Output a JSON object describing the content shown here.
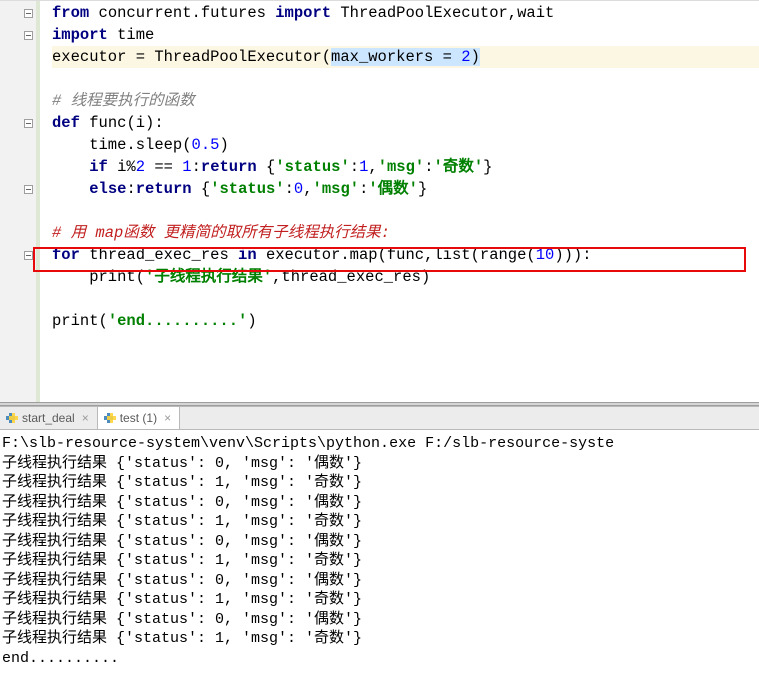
{
  "code": {
    "l1a": "from",
    "l1b": " concurrent.futures ",
    "l1c": "import",
    "l1d": " ThreadPoolExecutor,wait",
    "l2a": "import",
    "l2b": " time",
    "l3a": "executor = ThreadPoolExecutor(",
    "l3b": "max_workers = ",
    "l3c": "2",
    "l3d": ")",
    "l5": "# 线程要执行的函数",
    "l6a": "def ",
    "l6b": "func",
    "l6c": "(i):",
    "l7a": "    time.sleep(",
    "l7b": "0.5",
    "l7c": ")",
    "l8a": "    ",
    "l8b": "if ",
    "l8c": "i%",
    "l8d": "2",
    "l8e": " == ",
    "l8f": "1",
    "l8g": ":",
    "l8h": "return ",
    "l8i": "{",
    "l8j": "'status'",
    "l8k": ":",
    "l8l": "1",
    "l8m": ",",
    "l8n": "'msg'",
    "l8o": ":",
    "l8p": "'奇数'",
    "l8q": "}",
    "l9a": "    ",
    "l9b": "else",
    "l9c": ":",
    "l9d": "return ",
    "l9e": "{",
    "l9f": "'status'",
    "l9g": ":",
    "l9h": "0",
    "l9i": ",",
    "l9j": "'msg'",
    "l9k": ":",
    "l9l": "'偶数'",
    "l9m": "}",
    "l11": "# 用 map函数 更精简的取所有子线程执行结果:",
    "l12a": "for ",
    "l12b": "thread_exec_res ",
    "l12c": "in ",
    "l12d": "executor.map(func,list(range(",
    "l12e": "10",
    "l12f": "))):",
    "l13a": "    print(",
    "l13b": "'子线程执行结果'",
    "l13c": ",thread_exec_res)",
    "l15a": "print(",
    "l15b": "'end..........'",
    "l15c": ")"
  },
  "tabs": {
    "t1": "start_deal",
    "t2": "test (1)"
  },
  "console": {
    "path": "F:\\slb-resource-system\\venv\\Scripts\\python.exe F:/slb-resource-syste",
    "rows": [
      "子线程执行结果 {'status': 0, 'msg': '偶数'}",
      "子线程执行结果 {'status': 1, 'msg': '奇数'}",
      "子线程执行结果 {'status': 0, 'msg': '偶数'}",
      "子线程执行结果 {'status': 1, 'msg': '奇数'}",
      "子线程执行结果 {'status': 0, 'msg': '偶数'}",
      "子线程执行结果 {'status': 1, 'msg': '奇数'}",
      "子线程执行结果 {'status': 0, 'msg': '偶数'}",
      "子线程执行结果 {'status': 1, 'msg': '奇数'}",
      "子线程执行结果 {'status': 0, 'msg': '偶数'}",
      "子线程执行结果 {'status': 1, 'msg': '奇数'}"
    ],
    "end": "end.........."
  }
}
